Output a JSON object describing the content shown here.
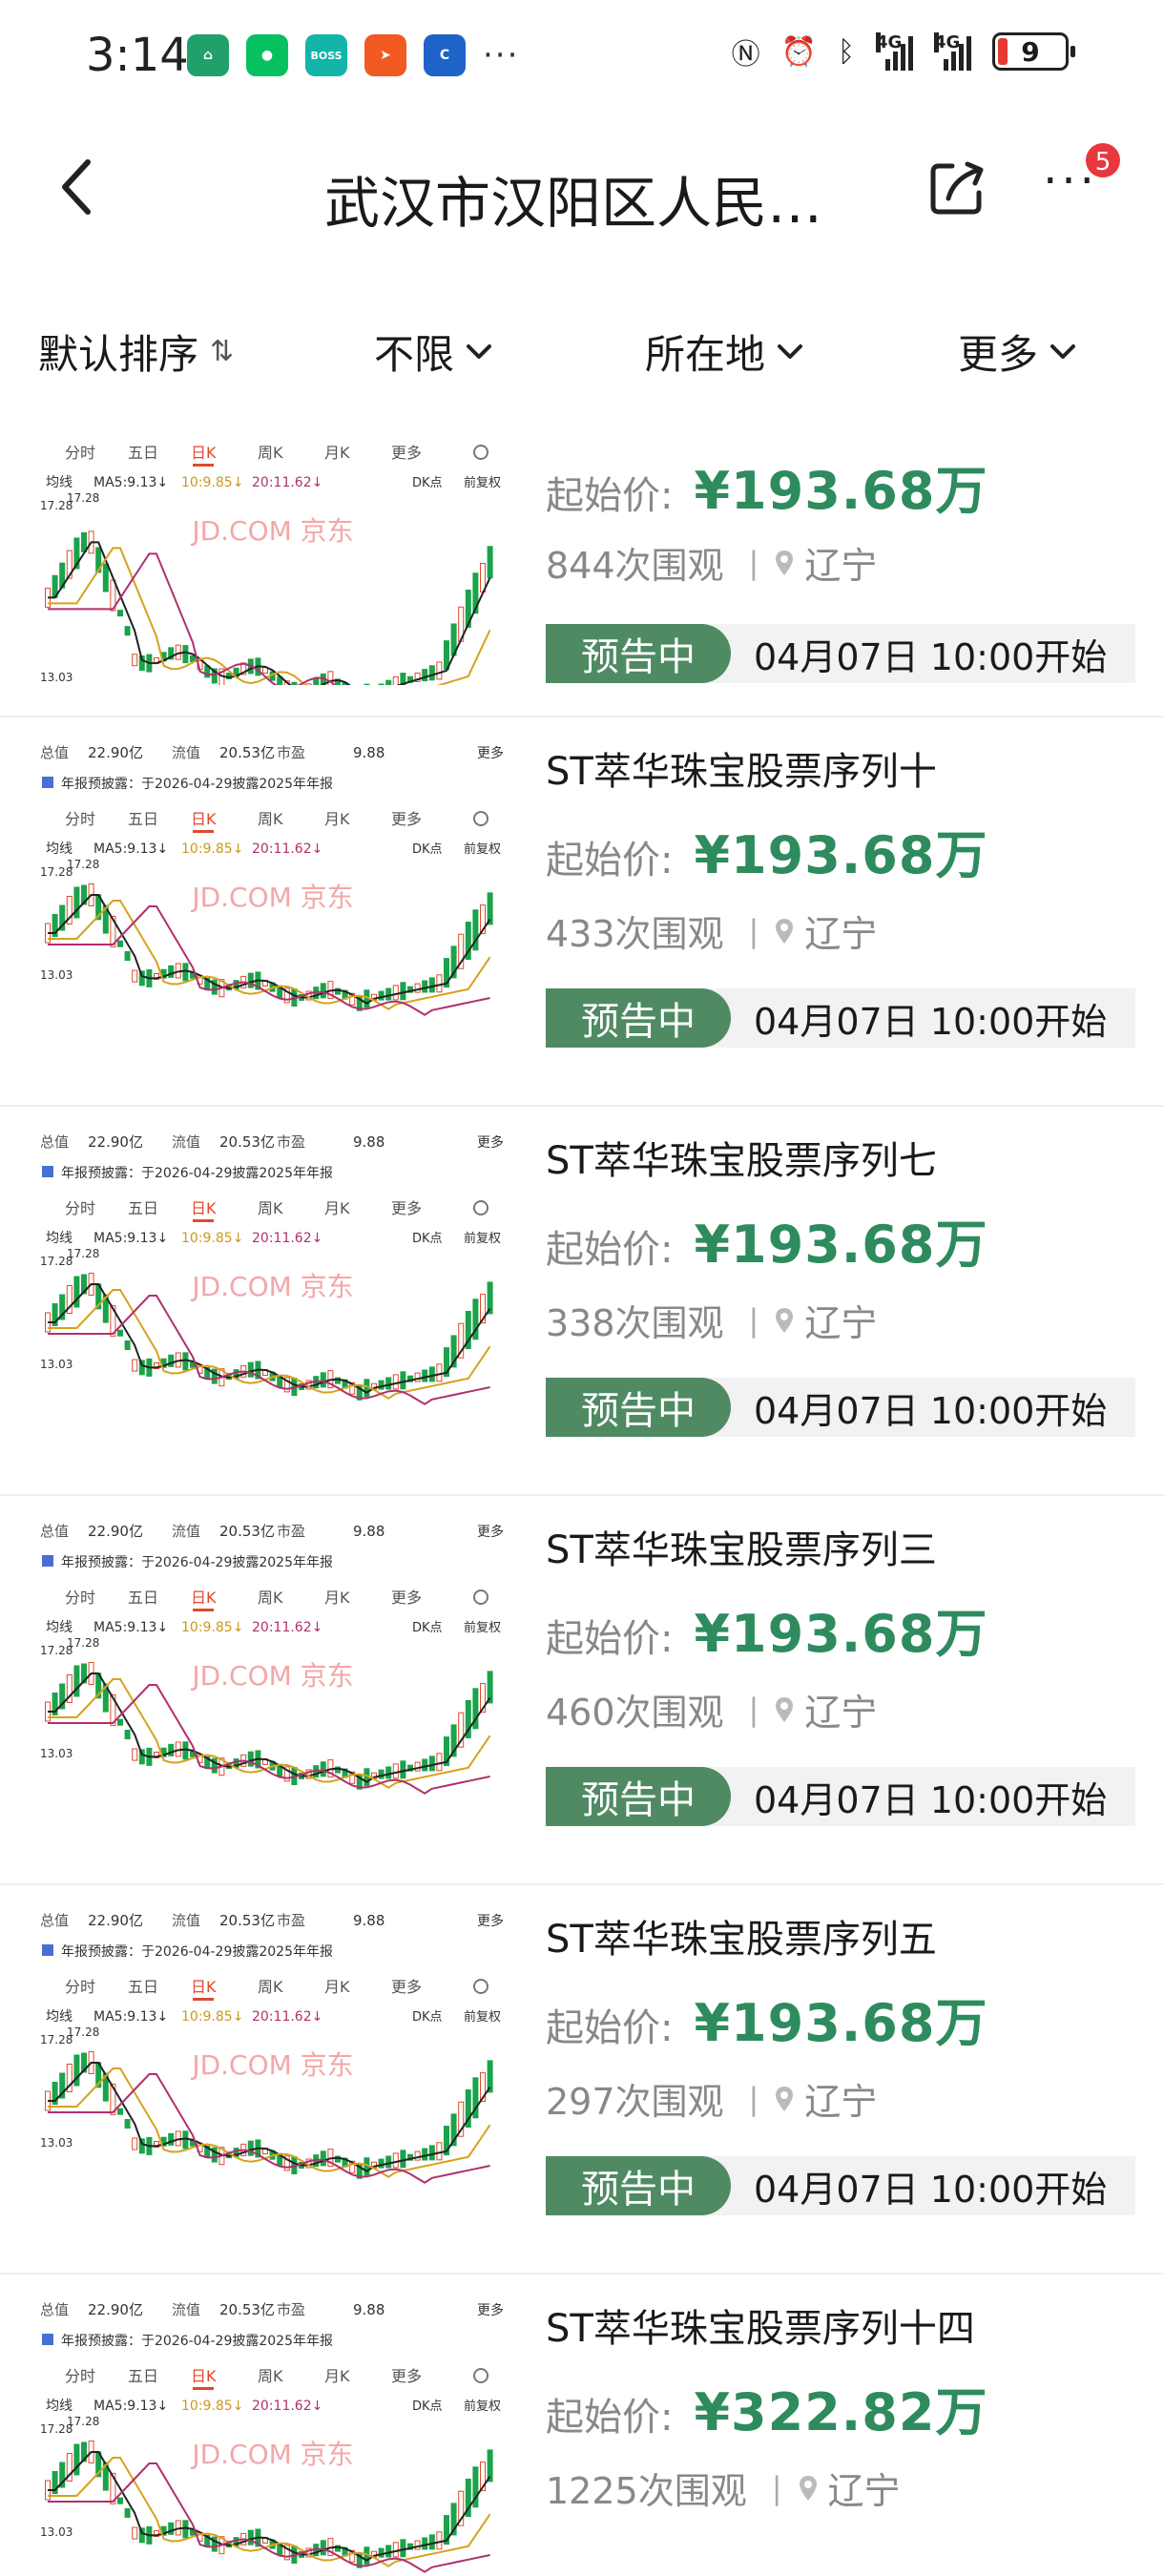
{
  "status_bar": {
    "time": "3:14",
    "app_icons": [
      {
        "name": "home-app-icon",
        "color": "#22a06b",
        "text": "⌂"
      },
      {
        "name": "wechat-app-icon",
        "color": "#07c160",
        "text": "●"
      },
      {
        "name": "boss-app-icon",
        "color": "#12b5a8",
        "text": "BOSS"
      },
      {
        "name": "paper-plane-app-icon",
        "color": "#f15a22",
        "text": "➤"
      },
      {
        "name": "blue-app-icon",
        "color": "#1e63c8",
        "text": "C"
      }
    ],
    "more_apps": "···",
    "network_label_1": "4G",
    "network_label_2": "4G",
    "battery": "9"
  },
  "header": {
    "title": "武汉市汉阳区人民…",
    "notification_count": "5"
  },
  "filters": [
    {
      "label": "默认排序",
      "icon": "sort-icon"
    },
    {
      "label": "不限",
      "icon": "chevron-down-icon"
    },
    {
      "label": "所在地",
      "icon": "chevron-down-icon"
    },
    {
      "label": "更多",
      "icon": "chevron-down-icon"
    }
  ],
  "thumbnail": {
    "tabs": [
      "分时",
      "五日",
      "日K",
      "周K",
      "月K",
      "更多"
    ],
    "active_tab": "日K",
    "ma_label": "均线",
    "ma5": "MA5:9.13↓",
    "ma10": "10:9.85↓",
    "ma20": "20:11.62↓",
    "dk_label": "DK点",
    "fq_label": "前复权",
    "high": "17.28",
    "low": "13.03",
    "watermark": "JD.COM 京东",
    "stats_row": [
      "总值",
      "22.90亿",
      "流值",
      "20.53亿",
      "市盈",
      "9.88",
      "更多"
    ],
    "disclosure": "年报预披露：于2026-04-29披露2025年年报"
  },
  "items": [
    {
      "title": "",
      "price_label": "起始价:",
      "price": "¥193.68万",
      "views": "844次围观",
      "location": "辽宁",
      "status": "预告中",
      "start_time": "04月07日 10:00开始"
    },
    {
      "title": "ST萃华珠宝股票序列十",
      "price_label": "起始价:",
      "price": "¥193.68万",
      "views": "433次围观",
      "location": "辽宁",
      "status": "预告中",
      "start_time": "04月07日 10:00开始"
    },
    {
      "title": "ST萃华珠宝股票序列七",
      "price_label": "起始价:",
      "price": "¥193.68万",
      "views": "338次围观",
      "location": "辽宁",
      "status": "预告中",
      "start_time": "04月07日 10:00开始"
    },
    {
      "title": "ST萃华珠宝股票序列三",
      "price_label": "起始价:",
      "price": "¥193.68万",
      "views": "460次围观",
      "location": "辽宁",
      "status": "预告中",
      "start_time": "04月07日 10:00开始"
    },
    {
      "title": "ST萃华珠宝股票序列五",
      "price_label": "起始价:",
      "price": "¥193.68万",
      "views": "297次围观",
      "location": "辽宁",
      "status": "预告中",
      "start_time": "04月07日 10:00开始"
    },
    {
      "title": "ST萃华珠宝股票序列十四",
      "price_label": "起始价:",
      "price": "¥322.82万",
      "views": "1225次围观",
      "location": "辽宁",
      "status": "",
      "start_time": ""
    }
  ]
}
